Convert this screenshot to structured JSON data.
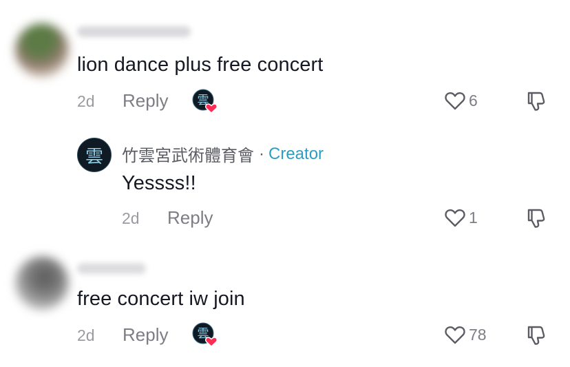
{
  "comments": [
    {
      "text": "lion dance plus free concert",
      "time": "2d",
      "reply_label": "Reply",
      "likes": "6",
      "liked_by_creator": true,
      "user_blurred": true,
      "avatar_colors": [
        "#5c7b45",
        "#8c7a6a"
      ]
    },
    {
      "text": "free concert iw join",
      "time": "2d",
      "reply_label": "Reply",
      "likes": "78",
      "liked_by_creator": true,
      "user_blurred": true,
      "avatar_colors": [
        "#6f6f6f",
        "#c2c2c2"
      ]
    }
  ],
  "creator_reply": {
    "username": "竹雲宮武術體育會",
    "separator": "·",
    "creator_badge": "Creator",
    "text": "Yessss!!",
    "time": "2d",
    "reply_label": "Reply",
    "likes": "1",
    "avatar_glyph": "雲"
  },
  "colors": {
    "text": "#161823",
    "secondary": "#7d7e85",
    "creator": "#2c9ec4",
    "heart_badge": "#fe2c55",
    "avatar_bg": "#0f1a24",
    "avatar_glyph": "#8fd0e8"
  },
  "icons": {
    "like": "heart-outline-icon",
    "dislike": "thumbs-down-icon",
    "creator_liked": "creator-heart-badge-icon"
  }
}
